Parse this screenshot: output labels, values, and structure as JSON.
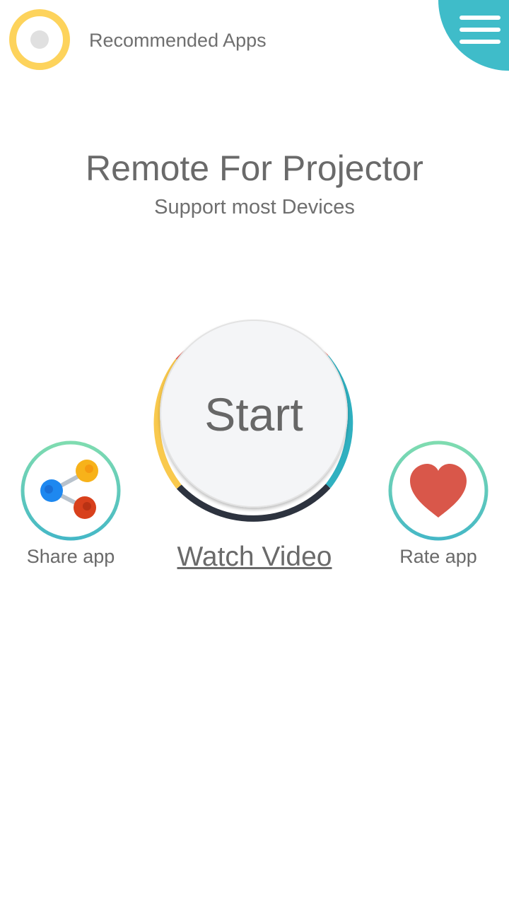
{
  "header": {
    "recommended_label": "Recommended Apps",
    "recommended_icon": "ring-icon",
    "menu_icon": "hamburger-menu-icon"
  },
  "main": {
    "title": "Remote For Projector",
    "subtitle": "Support most Devices",
    "start_label": "Start",
    "watch_video_label": "Watch Video"
  },
  "actions": {
    "share_label": "Share app",
    "share_icon": "share-icon",
    "rate_label": "Rate app",
    "rate_icon": "heart-icon"
  },
  "colors": {
    "ring_yellow": "#fdd35c",
    "menu_teal": "#3fbcc9",
    "arc_red": "#e65a4f",
    "arc_teal": "#2fb0c0",
    "arc_dark": "#2d333f",
    "arc_yellow": "#f9c94d",
    "heart_red": "#d9574a",
    "text_gray": "#6a6a6a"
  }
}
